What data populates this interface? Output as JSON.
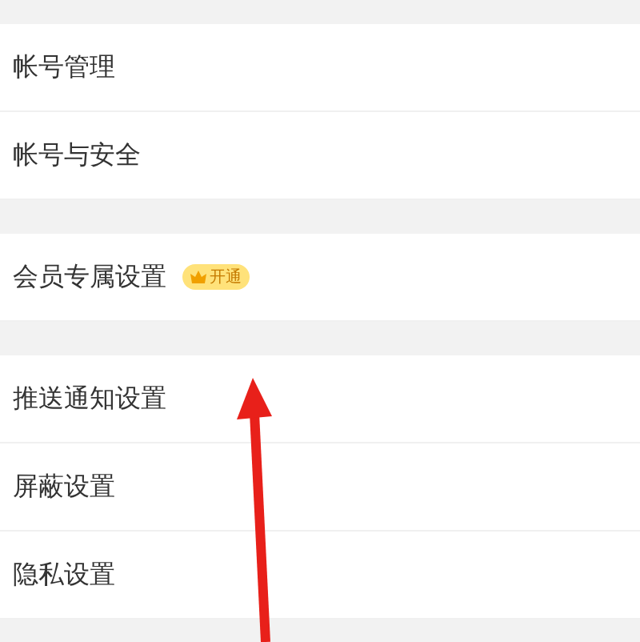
{
  "sections": [
    {
      "items": [
        {
          "label": "帐号管理"
        },
        {
          "label": "帐号与安全"
        }
      ]
    },
    {
      "items": [
        {
          "label": "会员专属设置",
          "badge": "开通"
        }
      ]
    },
    {
      "items": [
        {
          "label": "推送通知设置"
        },
        {
          "label": "屏蔽设置"
        },
        {
          "label": "隐私设置"
        }
      ]
    }
  ]
}
